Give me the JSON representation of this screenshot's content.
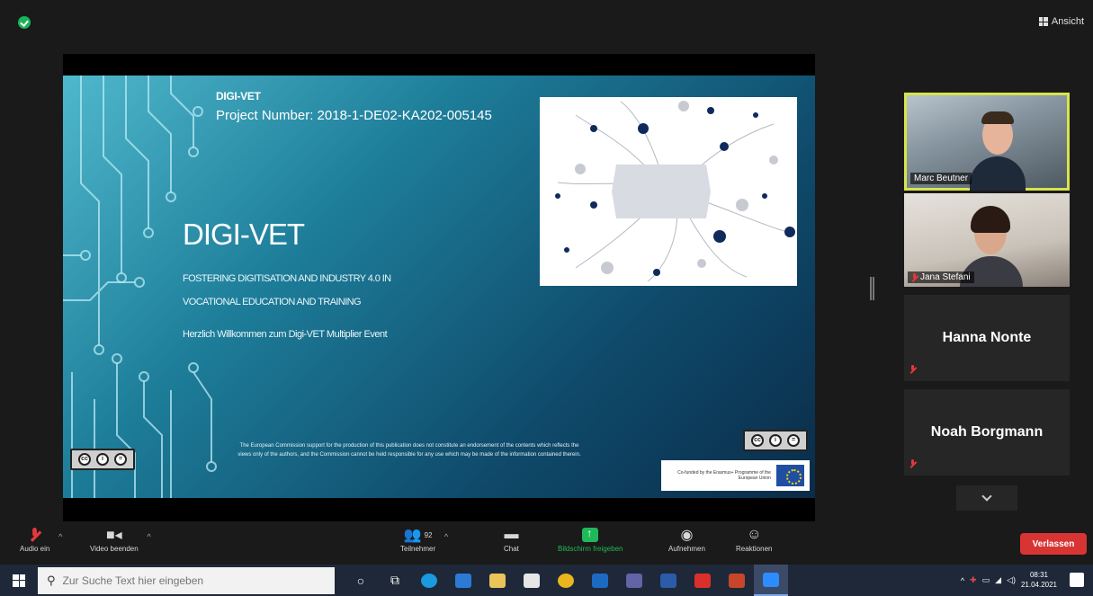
{
  "topbar": {
    "view_label": "Ansicht"
  },
  "slide": {
    "project_name": "DIGI-VET",
    "project_number": "Project Number: 2018-1-DE02-KA202-005145",
    "title": "DIGI-VET",
    "subtitle_line1": "FOSTERING DIGITISATION AND INDUSTRY 4.0 IN",
    "subtitle_line2": "VOCATIONAL EDUCATION AND TRAINING",
    "welcome": "Herzlich Willkommen zum Digi-VET Multiplier Event",
    "disclaimer": "The European Commission support for the production of this publication does not constitute an endorsement of the contents which reflects the views only of the authors, and the Commission cannot be held responsible for any use which may be made of the information contained therein.",
    "eu_text": "Co-funded by the Erasmus+ Programme of the European Union"
  },
  "participants": [
    {
      "name": "Marc Beutner",
      "has_video": true
    },
    {
      "name": "Jana Stefani",
      "has_video": true
    },
    {
      "name": "Hanna Nonte",
      "has_video": false
    },
    {
      "name": "Noah Borgmann",
      "has_video": false
    }
  ],
  "toolbar": {
    "audio": "Audio ein",
    "video": "Video beenden",
    "participants": "Teilnehmer",
    "participants_count": "92",
    "chat": "Chat",
    "share": "Bildschirm freigeben",
    "record": "Aufnehmen",
    "reactions": "Reaktionen",
    "leave": "Verlassen"
  },
  "taskbar": {
    "search_placeholder": "Zur Suche Text hier eingeben",
    "time": "08:31",
    "date": "21.04.2021"
  },
  "colors": {
    "accent_green": "#1fb95a",
    "leave_red": "#d93434",
    "active_speaker": "#d8e44a"
  }
}
